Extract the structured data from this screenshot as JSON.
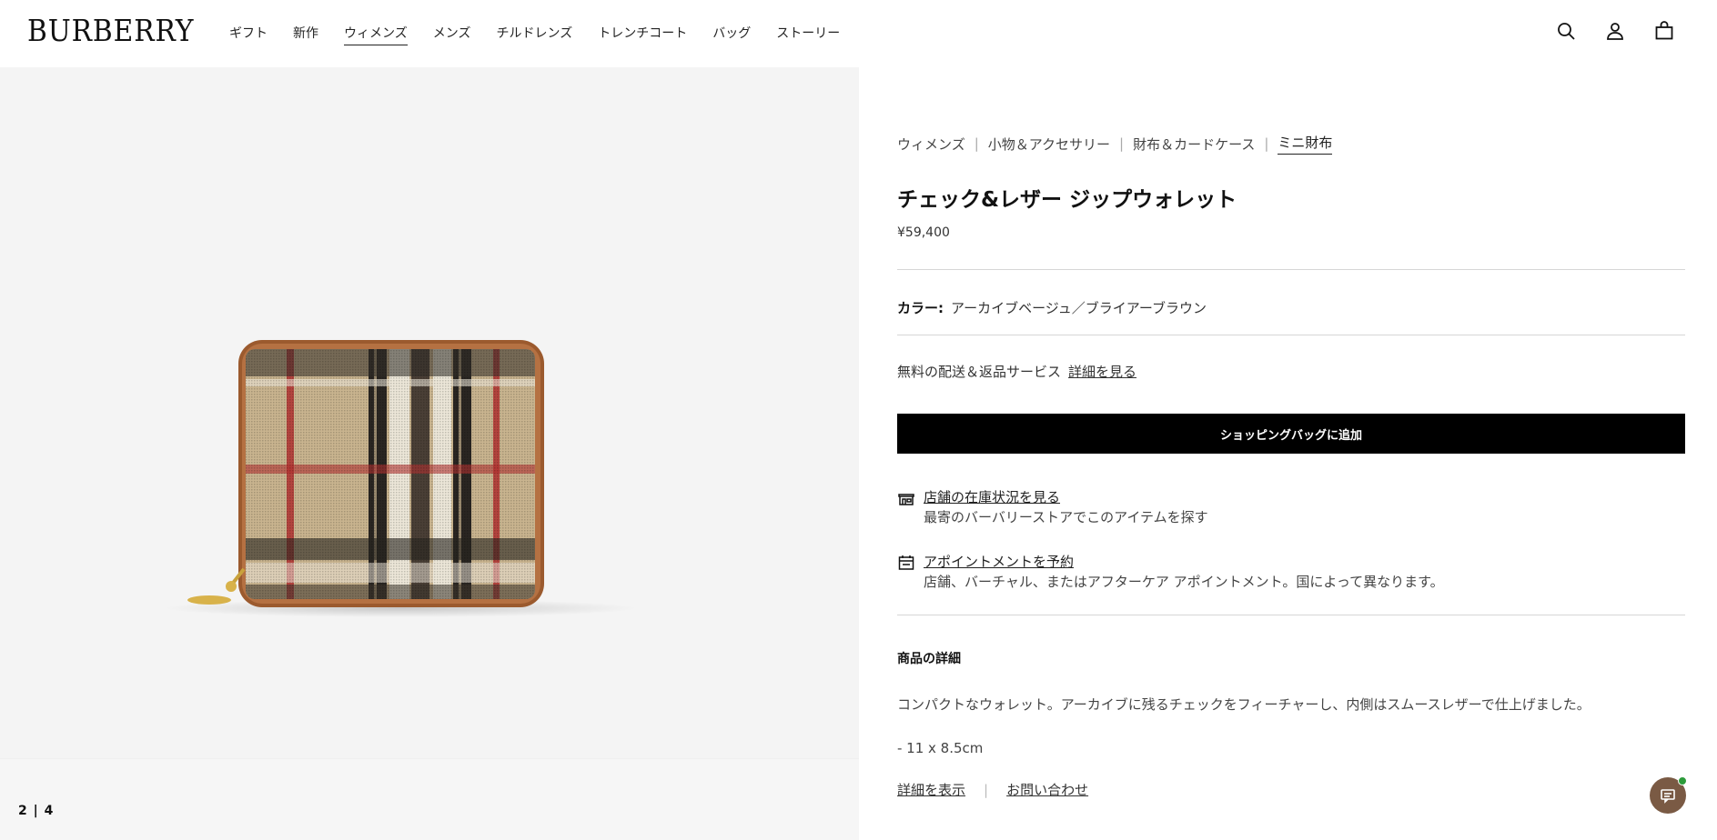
{
  "header": {
    "logo": "BURBERRY",
    "nav": [
      "ギフト",
      "新作",
      "ウィメンズ",
      "メンズ",
      "チルドレンズ",
      "トレンチコート",
      "バッグ",
      "ストーリー"
    ],
    "active_nav": "ウィメンズ",
    "icons": [
      "search-icon",
      "account-icon",
      "shopping-bag-icon"
    ]
  },
  "gallery": {
    "counter": "2 | 4"
  },
  "product": {
    "breadcrumb": [
      "ウィメンズ",
      "小物＆アクセサリー",
      "財布＆カードケース",
      "ミニ財布"
    ],
    "title": "チェック&レザー ジップウォレット",
    "price": "¥59,400",
    "color_label": "カラー:",
    "color_value": "アーカイブベージュ／ブライアーブラウン",
    "shipping_text": "無料の配送＆返品サービス",
    "shipping_link": "詳細を見る",
    "add_to_bag": "ショッピングバッグに追加",
    "store_stock_title": "店舗の在庫状況を見る",
    "store_stock_sub": "最寄のバーバリーストアでこのアイテムを探す",
    "appointment_title": "アポイントメントを予約",
    "appointment_sub": "店舗、バーチャル、またはアフターケア アポイントメント。国によって異なります。",
    "details_heading": "商品の詳細",
    "details_desc": "コンパクトなウォレット。アーカイブに残るチェックをフィーチャーし、内側はスムースレザーで仕上げました。",
    "details_size": "- 11 x 8.5cm",
    "more_details": "詳細を表示",
    "contact": "お問い合わせ"
  },
  "colors": {
    "accent": "#000000",
    "chat_bg": "#7a5a44",
    "chat_status": "#2c9b3a"
  }
}
